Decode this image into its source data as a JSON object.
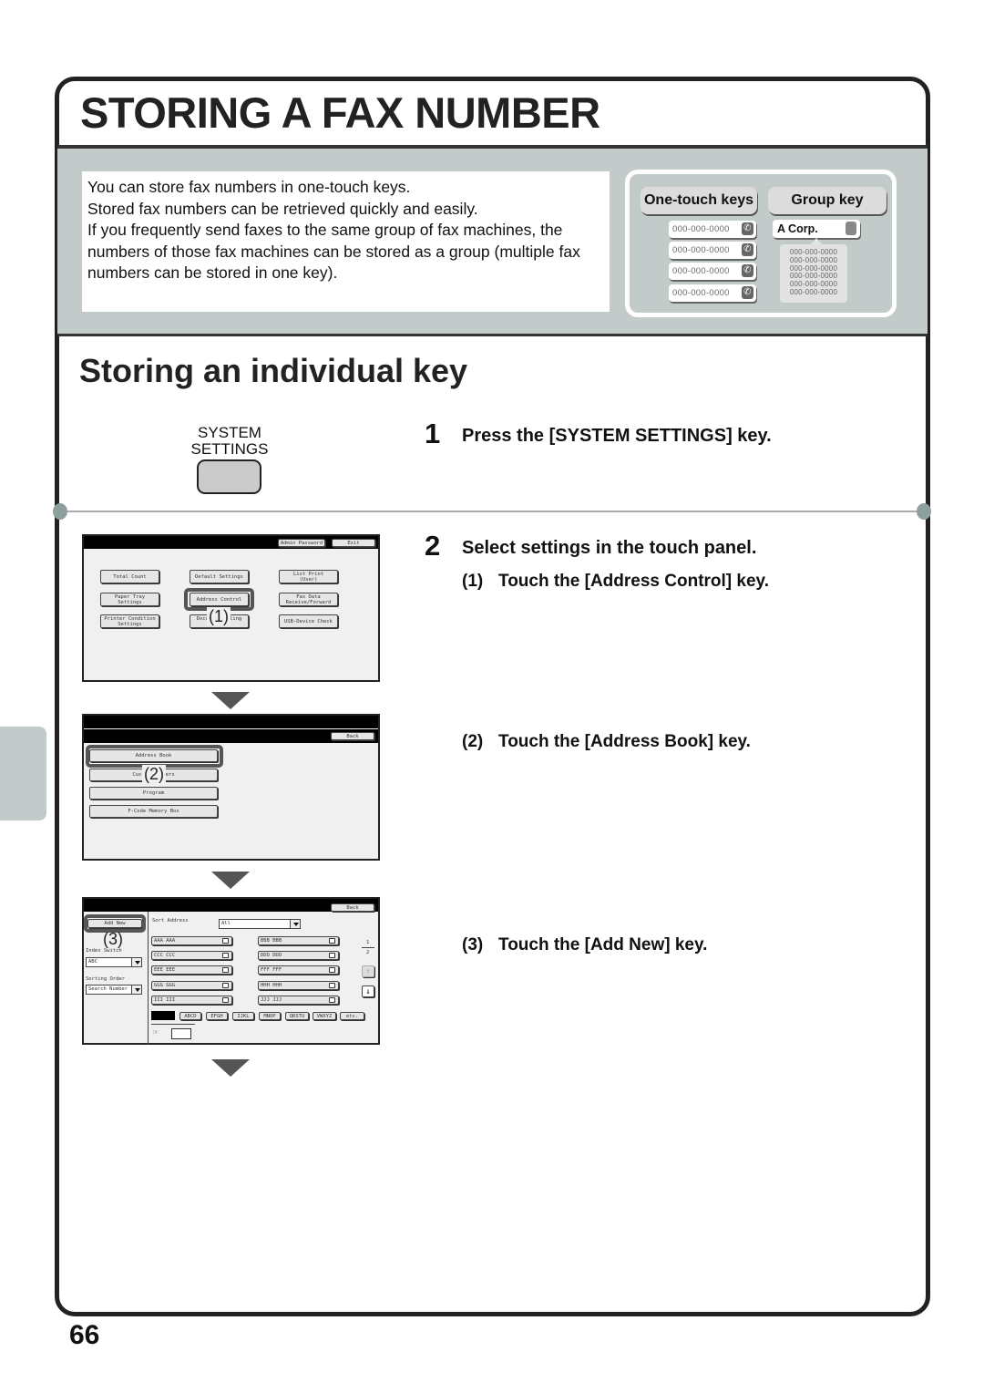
{
  "page": {
    "title": "STORING A FAX NUMBER",
    "page_number": "66"
  },
  "intro": {
    "lines": [
      "You can store fax numbers in one-touch keys.",
      "Stored fax numbers can be retrieved quickly and easily.",
      "If you frequently send faxes to the same group of fax machines, the numbers of those fax machines can be stored as a group (multiple fax numbers can be stored in one key)."
    ]
  },
  "illustration": {
    "one_touch_tab": "One-touch keys",
    "group_tab": "Group key",
    "one_touch_numbers": [
      "000-000-0000",
      "000-000-0000",
      "000-000-0000",
      "000-000-0000"
    ],
    "phone_icon": "phone-icon",
    "group_key_label": "A Corp.",
    "group_icon": "people-icon",
    "group_numbers": [
      "000-000-0000",
      "000-000-0000",
      "000-000-0000",
      "000-000-0000",
      "000-000-0000",
      "000-000-0000"
    ]
  },
  "section": {
    "heading": "Storing an individual key"
  },
  "system_key": {
    "label_line1": "SYSTEM",
    "label_line2": "SETTINGS"
  },
  "steps": [
    {
      "number": "1",
      "text": "Press the [SYSTEM SETTINGS] key."
    },
    {
      "number": "2",
      "text": "Select settings in the touch panel.",
      "substeps": [
        {
          "number": "(1)",
          "text": "Touch the [Address Control] key."
        },
        {
          "number": "(2)",
          "text": "Touch the [Address Book] key."
        },
        {
          "number": "(3)",
          "text": "Touch the [Add New] key."
        }
      ]
    }
  ],
  "screen1": {
    "admin_password": "Admin Password",
    "exit": "Exit",
    "buttons": [
      "Total Count",
      "Default Settings",
      "List Print\n(User)",
      "Paper Tray\nSettings",
      "Address Control",
      "Fax Data\nReceive/Forward",
      "Printer Condition\nSettings",
      "Document Filing\nControl",
      "USB-Device Check"
    ],
    "callout": "(1)"
  },
  "screen2": {
    "back": "Back",
    "buttons": [
      "Address Book",
      "Custom Folders",
      "Program",
      "F-Code Memory Box"
    ],
    "callout": "(2)"
  },
  "screen3": {
    "back": "Back",
    "add_new": "Add New",
    "callout": "(3)",
    "sort_address_label": "Sort Address",
    "sort_address_value": "All",
    "index_switch_label": "Index Switch",
    "index_switch_value": "ABC",
    "sorting_order_label": "Sorting Order",
    "sorting_order_value": "Search Number",
    "entries": [
      "AAA AAA",
      "BBB BBB",
      "CCC CCC",
      "DDD DDD",
      "EEE EEE",
      "FFF FFF",
      "GGG GGG",
      "HHH HHH",
      "III III",
      "JJJ JJJ"
    ],
    "page_current": "1",
    "page_total": "2",
    "index_tabs": [
      "ABCD",
      "EFGH",
      "IJKL",
      "MNOP",
      "QRSTU",
      "VWXYZ",
      "etc."
    ]
  }
}
